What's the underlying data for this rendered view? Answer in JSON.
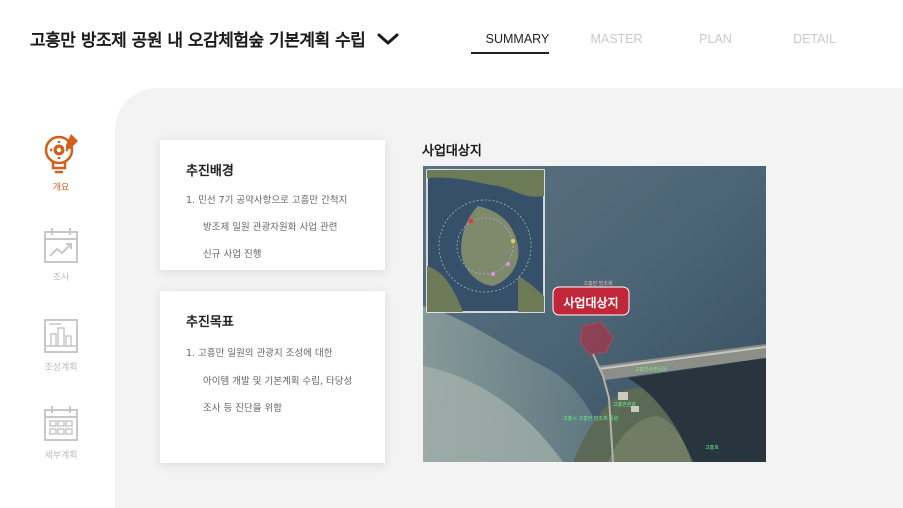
{
  "header": {
    "title": "고흥만 방조제 공원 내 오감체험숲 기본계획 수립",
    "tabs": [
      {
        "label": "SUMMARY",
        "active": true
      },
      {
        "label": "MASTER",
        "active": false
      },
      {
        "label": "PLAN",
        "active": false
      },
      {
        "label": "DETAIL",
        "active": false
      }
    ]
  },
  "sidebar": {
    "items": [
      {
        "label": "개요",
        "icon": "lightbulb-gear-icon",
        "active": true
      },
      {
        "label": "조사",
        "icon": "calendar-chart-icon",
        "active": false
      },
      {
        "label": "조성계획",
        "icon": "blueprint-building-icon",
        "active": false
      },
      {
        "label": "세부계획",
        "icon": "calendar-grid-icon",
        "active": false
      }
    ]
  },
  "cards": [
    {
      "title": "추진배경",
      "lines": [
        "1.  민선 7기 공약사항으로 고흥만 간척지",
        "방조제 일원 관광자원화 사업 관련",
        "신규 사업 진행"
      ]
    },
    {
      "title": "추진목표",
      "lines": [
        "1.  고흥만 일원의 관광지 조성에 대한",
        "아이템 개발 및 기본계획 수립, 타당성",
        "조사 등 진단을 위함"
      ]
    }
  ],
  "site": {
    "title": "사업대상지",
    "map_label": "사업대상지",
    "map_small_label": "고흥만 방조제",
    "map_tags": [
      "고흥만수변공원",
      "고흥만관광",
      "고흥시 고흥만 방조제 공원",
      "고흥호"
    ]
  },
  "colors": {
    "accent": "#d35f1a",
    "inactive": "#c9c9c9",
    "panel": "#f3f3f3",
    "map_label_bg": "#c0283a"
  }
}
